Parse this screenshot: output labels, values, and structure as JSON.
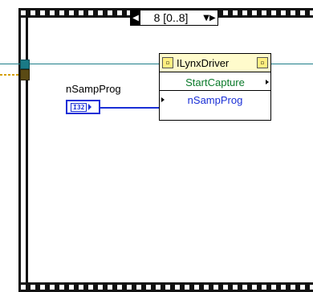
{
  "selector": {
    "value": "8 [0..8]",
    "left_arrow": "◀",
    "right_arrow": "▼▶"
  },
  "control": {
    "label": "nSampProg",
    "type": "I32"
  },
  "property_node": {
    "class_name": "ILynxDriver",
    "method": "StartCapture",
    "parameter": "nSampProg",
    "ref_glyph": "▫"
  },
  "colors": {
    "refnum_wire": "#1f7f8a",
    "i32_wire": "#1a2fd6",
    "method_text": "#0a7a2a",
    "error_wire": "#d4a000"
  },
  "icons": [
    "film-strip-frame-icon",
    "selector-increment-icon",
    "refnum-icon",
    "invoke-node-icon"
  ]
}
